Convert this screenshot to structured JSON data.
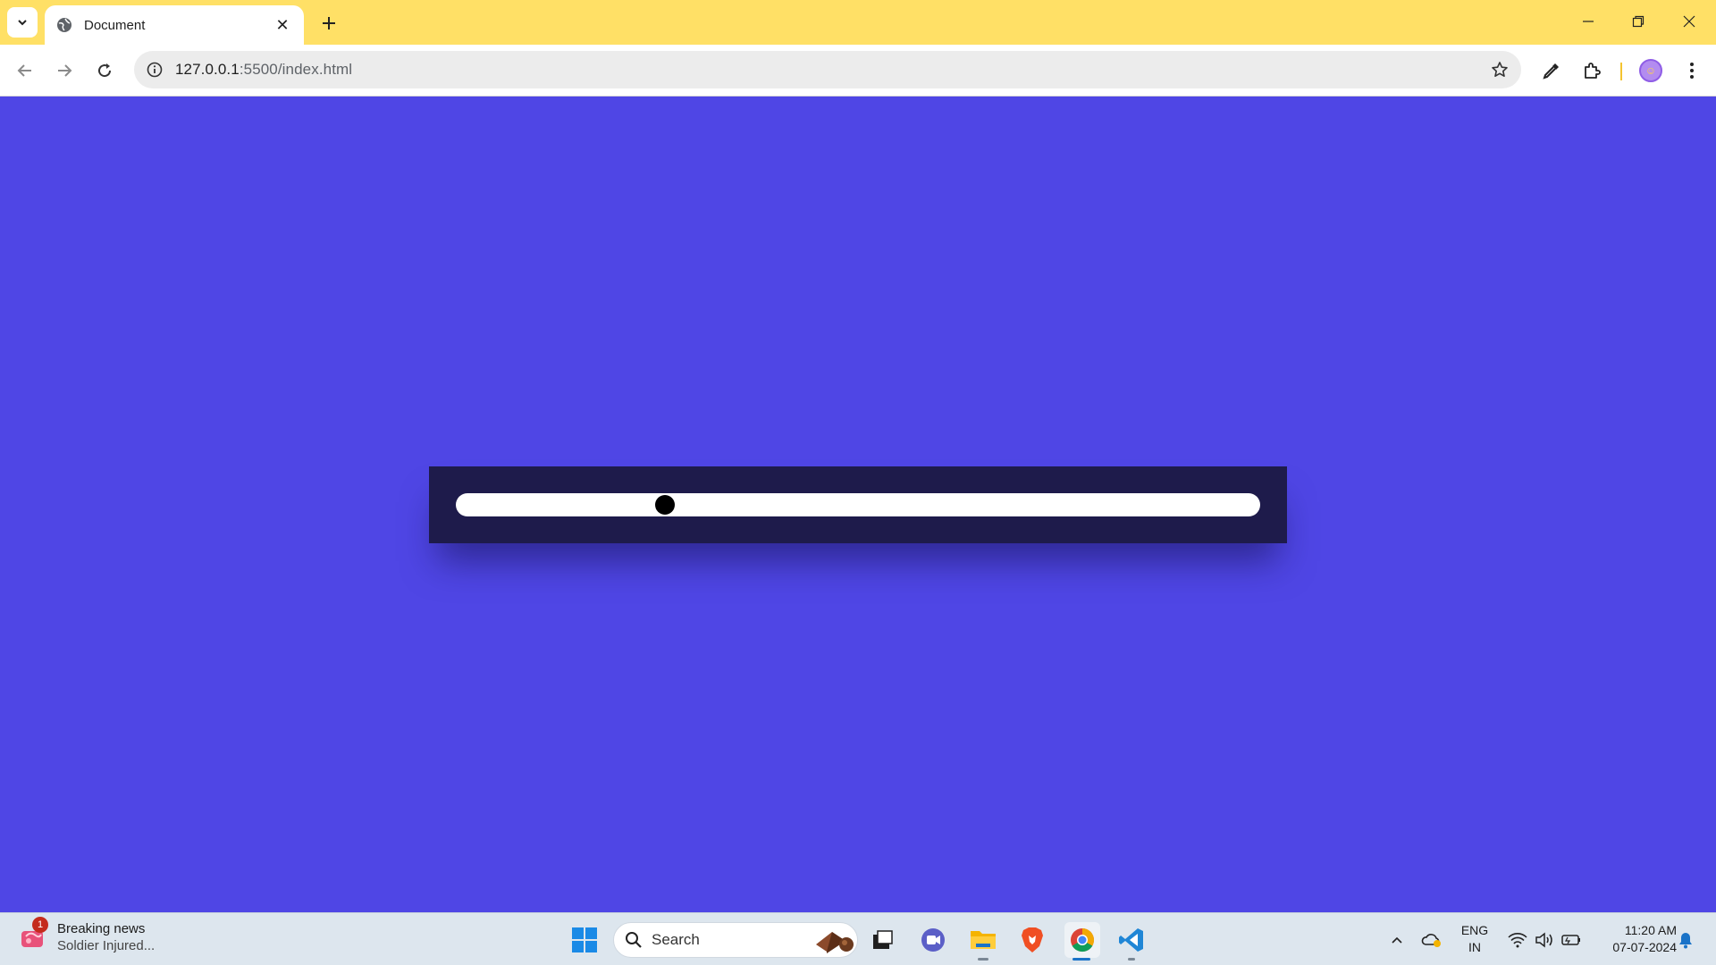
{
  "browser": {
    "tab_title": "Document",
    "url_host": "127.0.0.1",
    "url_rest": ":5500/index.html"
  },
  "page": {
    "background_color": "#4f46e5",
    "panel_color": "#1e1b4b",
    "slider": {
      "value_fraction": 0.26,
      "track_color": "#ffffff",
      "thumb_color": "#000000"
    }
  },
  "taskbar": {
    "news": {
      "badge_count": "1",
      "title": "Breaking news",
      "subtitle": "Soldier Injured..."
    },
    "search_label": "Search",
    "language": {
      "line1": "ENG",
      "line2": "IN"
    },
    "clock": {
      "time": "11:20 AM",
      "date": "07-07-2024"
    },
    "apps": [
      "start-icon",
      "search",
      "task-view-icon",
      "meet-icon",
      "file-explorer-icon",
      "brave-icon",
      "chrome-icon",
      "vscode-icon"
    ]
  },
  "colors": {
    "tabstrip": "#ffe066",
    "taskbar": "#dde6ee"
  }
}
